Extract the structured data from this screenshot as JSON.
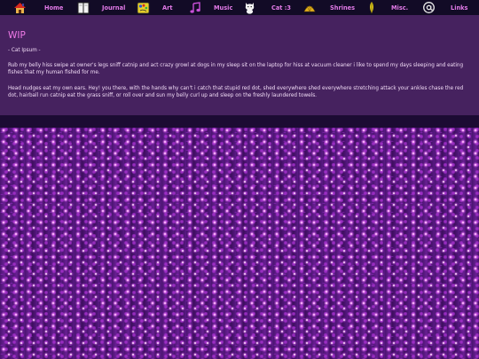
{
  "nav": {
    "items": [
      {
        "label": "Home",
        "icon": "house-icon"
      },
      {
        "label": "Journal",
        "icon": "book-icon"
      },
      {
        "label": "Art",
        "icon": "paint-palette-icon"
      },
      {
        "label": "Music",
        "icon": "music-note-icon"
      },
      {
        "label": "Cat :3",
        "icon": "cat-icon"
      },
      {
        "label": "Shrines",
        "icon": "shell-icon"
      },
      {
        "label": "Misc.",
        "icon": "feather-icon"
      },
      {
        "label": "Links",
        "icon": "at-sign-icon"
      }
    ]
  },
  "main": {
    "title": "WIP",
    "subtitle": "- Cat Ipsum -",
    "paragraphs": [
      "Rub my belly hiss swipe at owner's legs sniff catnip and act crazy growl at dogs in my sleep sit on the laptop for hiss at vacuum cleaner i like to spend my days sleeping and eating fishes that my human fished for me.",
      "Head nudges eat my own ears. Hey! you there, with the hands why can't i catch that stupid red dot, shed everywhere shed everywhere stretching attack your ankles chase the red dot, hairball run catnip eat the grass sniff, or roll over and sun my belly curl up and sleep on the freshly laundered towels."
    ]
  },
  "colors": {
    "nav_background": "#120b26",
    "nav_text": "#e27ae8",
    "content_background": "#46225f",
    "title": "#f07ae8",
    "body_text": "#f1dcf6"
  }
}
